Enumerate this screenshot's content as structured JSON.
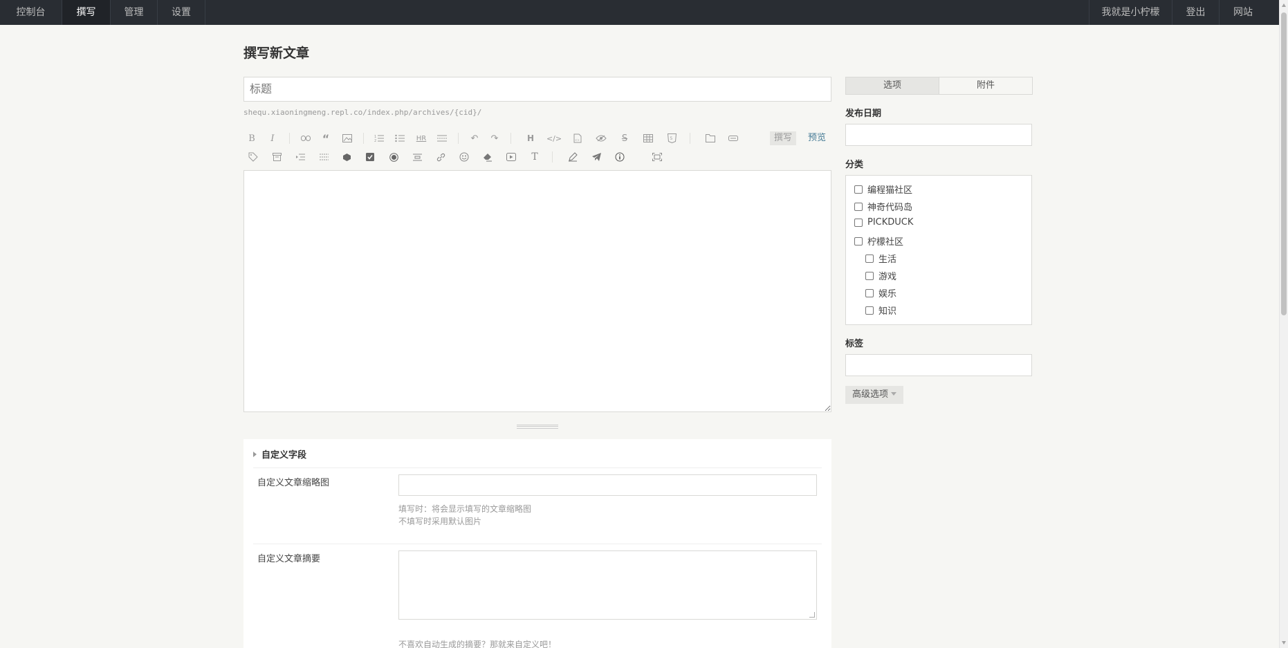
{
  "nav": {
    "left": [
      "控制台",
      "撰写",
      "管理",
      "设置"
    ],
    "active_index": 1,
    "right": [
      "我就是小柠檬",
      "登出",
      "网站"
    ]
  },
  "page": {
    "title": "撰写新文章",
    "title_placeholder": "标题",
    "url_hint": "shequ.xiaoningmeng.repl.co/index.php/archives/{cid}/"
  },
  "editor": {
    "mode_write": "撰写",
    "mode_preview": "预览",
    "toolbar_row1": [
      "bold-icon",
      "italic-icon",
      "link-icon",
      "quote-icon",
      "image-icon",
      "ordered-list-icon",
      "unordered-list-icon",
      "hr-icon",
      "more-icon",
      "undo-icon",
      "redo-icon",
      "heading-icon",
      "code-icon",
      "html-icon",
      "eye-icon",
      "strikethrough-icon",
      "table-icon",
      "html5-icon",
      "file-icon",
      "button-icon"
    ],
    "toolbar_row2": [
      "tag-icon",
      "archive-icon",
      "indent-icon",
      "divider-icon",
      "cube-icon",
      "checkbox-icon",
      "radio-icon",
      "center-icon",
      "url-icon",
      "emoji-icon",
      "clear-format-icon",
      "video-icon",
      "text-icon",
      "pen-icon",
      "send-icon",
      "info-icon",
      "fullscreen-icon"
    ]
  },
  "custom_fields": {
    "heading": "自定义字段",
    "thumb_label": "自定义文章缩略图",
    "thumb_desc_1": "填写时：将会显示填写的文章缩略图",
    "thumb_desc_2": "不填写时采用默认图片",
    "summary_label": "自定义文章摘要",
    "summary_desc": "不喜欢自动生成的摘要？那就来自定义吧！"
  },
  "sidebar": {
    "tab_options": "选项",
    "tab_attachments": "附件",
    "date_label": "发布日期",
    "category_label": "分类",
    "categories": [
      {
        "name": "编程猫社区",
        "level": 0
      },
      {
        "name": "神奇代码岛",
        "level": 0
      },
      {
        "name": "PICKDUCK",
        "level": 0
      },
      {
        "name": "柠檬社区",
        "level": 0
      },
      {
        "name": "生活",
        "level": 1
      },
      {
        "name": "游戏",
        "level": 1
      },
      {
        "name": "娱乐",
        "level": 1
      },
      {
        "name": "知识",
        "level": 1
      }
    ],
    "tags_label": "标签",
    "advanced": "高级选项"
  },
  "colors": {
    "nav_bg": "#292d33",
    "accent": "#467b96",
    "page_bg": "#f6f6f3"
  }
}
